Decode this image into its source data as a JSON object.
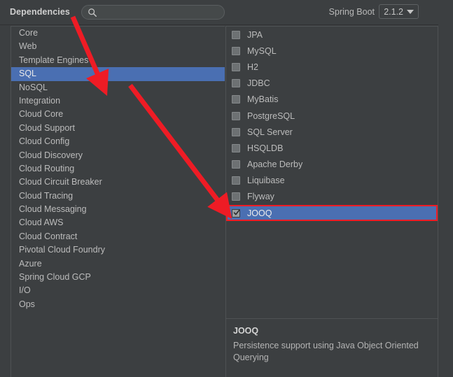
{
  "header": {
    "title": "Dependencies",
    "search": {
      "icon": "search-icon",
      "value": "",
      "placeholder": ""
    },
    "spring_boot_label": "Spring Boot",
    "version": "2.1.2",
    "version_caret_icon": "chevron-down-icon"
  },
  "categories": {
    "selected": "SQL",
    "items": [
      {
        "label": "Core",
        "selected": false
      },
      {
        "label": "Web",
        "selected": false
      },
      {
        "label": "Template Engines",
        "selected": false
      },
      {
        "label": "SQL",
        "selected": true
      },
      {
        "label": "NoSQL",
        "selected": false
      },
      {
        "label": "Integration",
        "selected": false
      },
      {
        "label": "Cloud Core",
        "selected": false
      },
      {
        "label": "Cloud Support",
        "selected": false
      },
      {
        "label": "Cloud Config",
        "selected": false
      },
      {
        "label": "Cloud Discovery",
        "selected": false
      },
      {
        "label": "Cloud Routing",
        "selected": false
      },
      {
        "label": "Cloud Circuit Breaker",
        "selected": false
      },
      {
        "label": "Cloud Tracing",
        "selected": false
      },
      {
        "label": "Cloud Messaging",
        "selected": false
      },
      {
        "label": "Cloud AWS",
        "selected": false
      },
      {
        "label": "Cloud Contract",
        "selected": false
      },
      {
        "label": "Pivotal Cloud Foundry",
        "selected": false
      },
      {
        "label": "Azure",
        "selected": false
      },
      {
        "label": "Spring Cloud GCP",
        "selected": false
      },
      {
        "label": "I/O",
        "selected": false
      },
      {
        "label": "Ops",
        "selected": false
      }
    ]
  },
  "dependencies": {
    "items": [
      {
        "label": "JPA",
        "checked": false,
        "selected": false
      },
      {
        "label": "MySQL",
        "checked": false,
        "selected": false
      },
      {
        "label": "H2",
        "checked": false,
        "selected": false
      },
      {
        "label": "JDBC",
        "checked": false,
        "selected": false
      },
      {
        "label": "MyBatis",
        "checked": false,
        "selected": false
      },
      {
        "label": "PostgreSQL",
        "checked": false,
        "selected": false
      },
      {
        "label": "SQL Server",
        "checked": false,
        "selected": false
      },
      {
        "label": "HSQLDB",
        "checked": false,
        "selected": false
      },
      {
        "label": "Apache Derby",
        "checked": false,
        "selected": false
      },
      {
        "label": "Liquibase",
        "checked": false,
        "selected": false
      },
      {
        "label": "Flyway",
        "checked": false,
        "selected": false
      },
      {
        "label": "JOOQ",
        "checked": true,
        "selected": true
      }
    ]
  },
  "description": {
    "title": "JOOQ",
    "text": "Persistence support using Java Object Oriented Querying"
  },
  "annotations": {
    "arrow_color": "#ee1c25",
    "highlight_color": "#ee1c25",
    "selection_color": "#4a6fb2",
    "arrows": [
      {
        "name": "arrow-to-sql-category",
        "from": [
          104,
          24
        ],
        "to": [
          148,
          120
        ]
      },
      {
        "name": "arrow-to-jooq-dependency",
        "from": [
          186,
          122
        ],
        "to": [
          322,
          298
        ]
      }
    ]
  }
}
